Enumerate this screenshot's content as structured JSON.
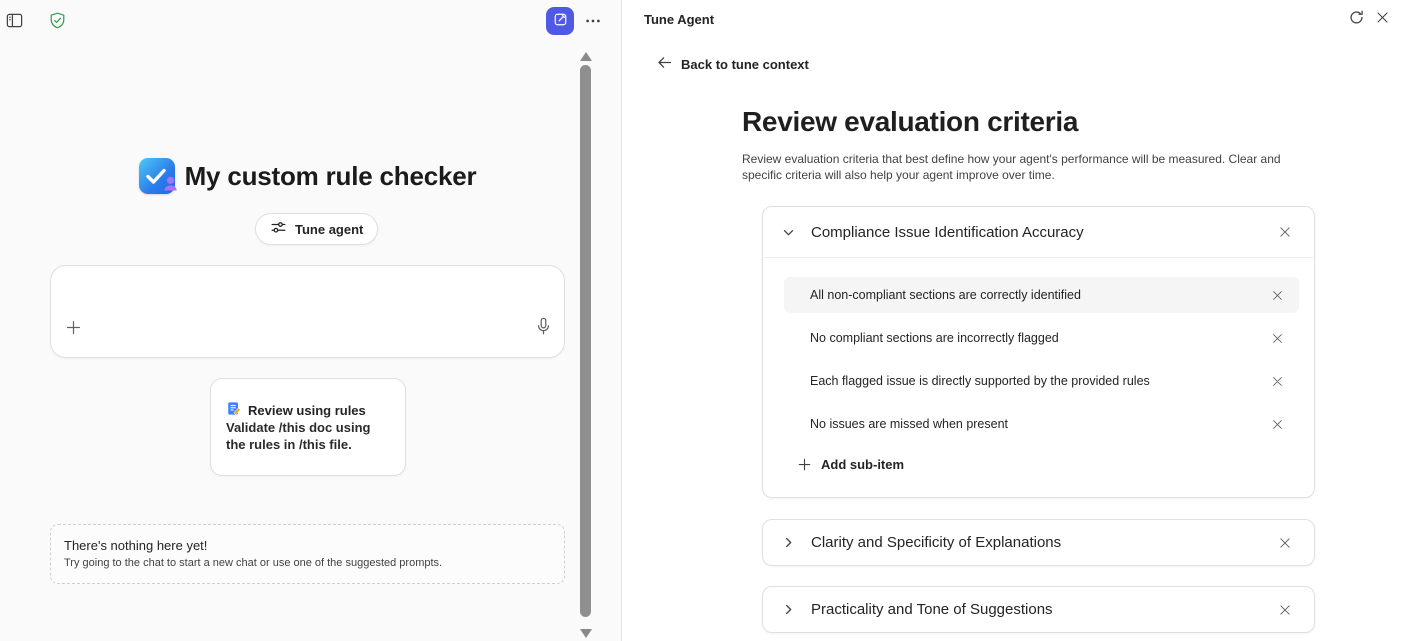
{
  "colors": {
    "accent": "#5059e6",
    "shield_green": "#2f9e44",
    "text_dark": "#242424",
    "text_gray": "#616161",
    "panel_bg": "#fafafa"
  },
  "left_panel": {
    "agent_title": "My custom rule checker",
    "tune_agent_label": "Tune agent",
    "suggested_prompt": {
      "title": "Review using rules",
      "body": "Validate /this doc using the rules in /this file."
    },
    "empty_state": {
      "title": "There's nothing here yet!",
      "subtitle": "Try going to the chat to start a new chat or use one of the suggested prompts."
    }
  },
  "right_panel": {
    "title": "Tune Agent",
    "back_label": "Back to tune context",
    "heading": "Review evaluation criteria",
    "description": "Review evaluation criteria that best define how your agent's performance will be measured. Clear and specific criteria will also help your agent improve over time.",
    "criteria": [
      {
        "title": "Compliance Issue Identification Accuracy",
        "expanded": true,
        "sub_items": [
          "All non-compliant sections are correctly identified",
          "No compliant sections are incorrectly flagged",
          "Each flagged issue is directly supported by the provided rules",
          "No issues are missed when present"
        ],
        "add_sub_item_label": "Add sub-item"
      },
      {
        "title": "Clarity and Specificity of Explanations",
        "expanded": false
      },
      {
        "title": "Practicality and Tone of Suggestions",
        "expanded": false
      }
    ]
  }
}
